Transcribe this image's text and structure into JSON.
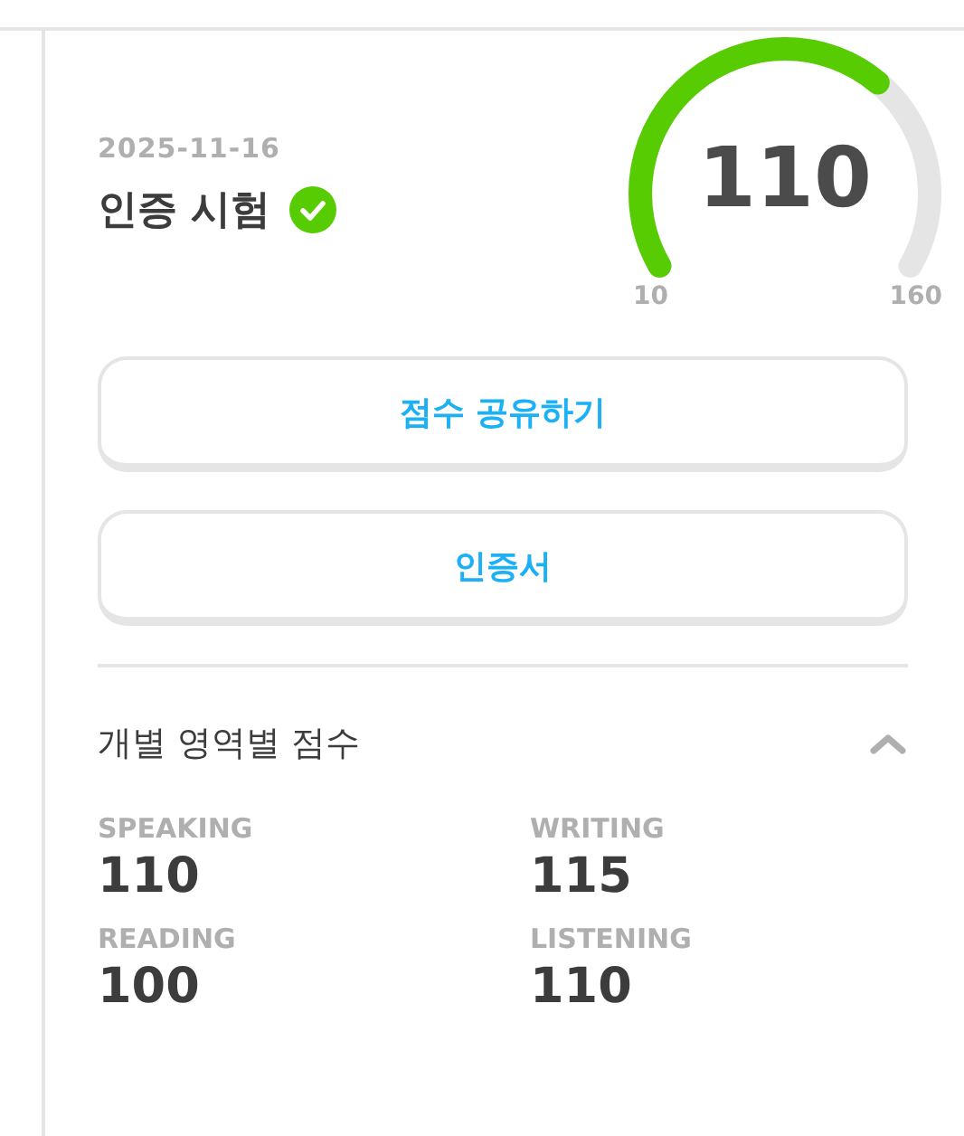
{
  "result": {
    "date": "2025-11-16",
    "title": "인증 시험",
    "verified": true
  },
  "gauge": {
    "score": "110",
    "min_label": "10",
    "max_label": "160"
  },
  "buttons": [
    "점수 공유하기",
    "인증서"
  ],
  "subscores": {
    "heading": "개별 영역별 점수",
    "expanded": true,
    "items": [
      {
        "label": "SPEAKING",
        "score": "110"
      },
      {
        "label": "WRITING",
        "score": "115"
      },
      {
        "label": "READING",
        "score": "100"
      },
      {
        "label": "LISTENING",
        "score": "110"
      }
    ]
  }
}
